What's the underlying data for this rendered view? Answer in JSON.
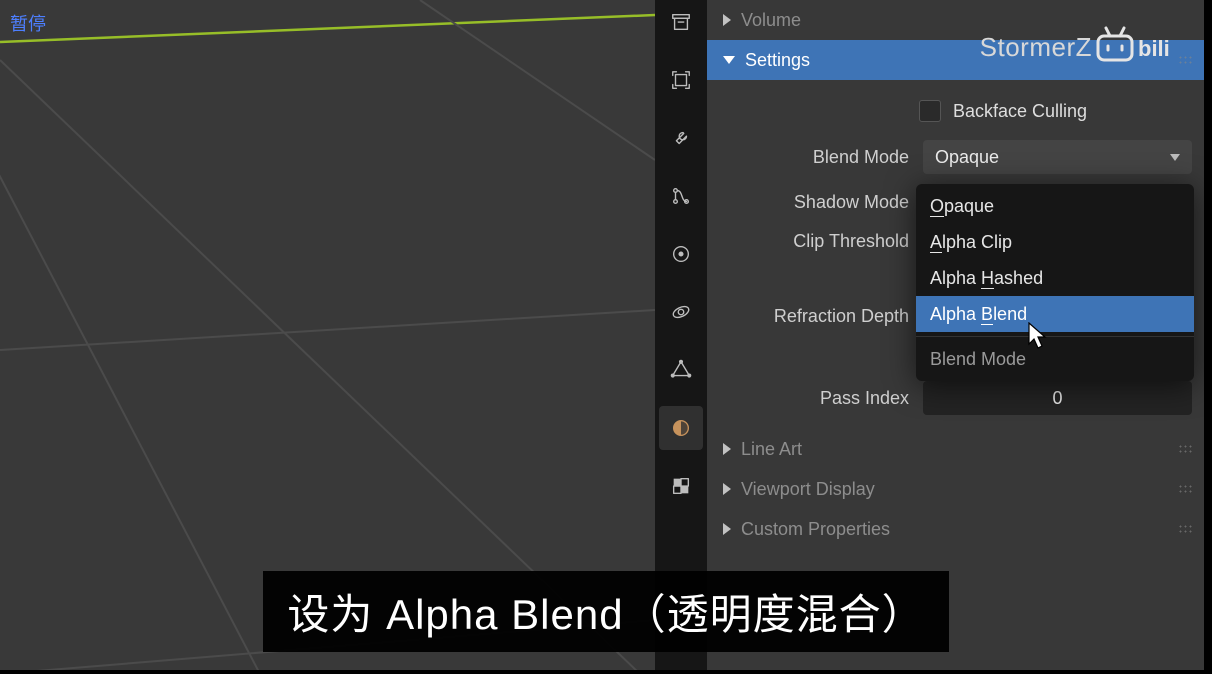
{
  "viewport": {
    "pause_label": "暂停",
    "grid_color": "#4b4b4b",
    "highlight_edge_color": "#97be28"
  },
  "tabs": {
    "items": [
      {
        "name": "render-tab"
      },
      {
        "name": "output-tab"
      },
      {
        "name": "tool-tab"
      },
      {
        "name": "scene-tab"
      },
      {
        "name": "world-tab"
      },
      {
        "name": "physics-tab"
      },
      {
        "name": "modifier-tab"
      },
      {
        "name": "material-tab",
        "selected": true
      },
      {
        "name": "texture-tab"
      }
    ]
  },
  "panel": {
    "volume_label": "Volume",
    "settings_label": "Settings",
    "backface_label": "Backface Culling",
    "blend_mode_label": "Blend Mode",
    "blend_mode_value": "Opaque",
    "shadow_mode_label": "Shadow Mode",
    "clip_threshold_label": "Clip Threshold",
    "refraction_depth_label": "Refraction Depth",
    "pass_index_label": "Pass Index",
    "pass_index_value": "0",
    "line_art_label": "Line Art",
    "viewport_display_label": "Viewport Display",
    "custom_props_label": "Custom Properties"
  },
  "dropdown": {
    "options": [
      {
        "label": "Opaque",
        "underline_index": 0
      },
      {
        "label": "Alpha Clip",
        "underline_index": 0
      },
      {
        "label": "Alpha Hashed",
        "underline_index": 6
      },
      {
        "label": "Alpha Blend",
        "underline_index": 6,
        "hover": true
      }
    ],
    "footer": "Blend Mode"
  },
  "watermark": {
    "text": "StormerZ",
    "logo": "bilibili"
  },
  "subtitle": "设为 Alpha Blend（透明度混合）"
}
